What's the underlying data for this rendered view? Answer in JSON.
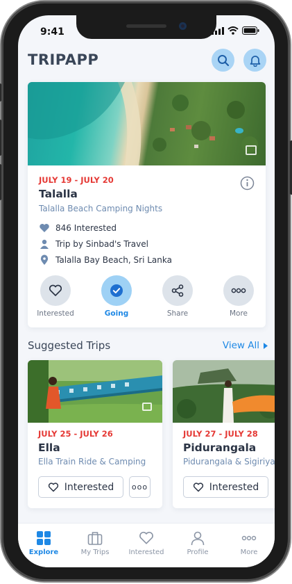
{
  "status_bar": {
    "time": "9:41"
  },
  "header": {
    "title": "TRIPAPP",
    "search_icon": "search-icon",
    "bell_icon": "bell-icon"
  },
  "featured": {
    "dates": "JULY 19 - JULY 20",
    "title": "Talalla",
    "subtitle": "Talalla Beach Camping Nights",
    "interested": "846 Interested",
    "organizer": "Trip by Sinbad's Travel",
    "location": "Talalla Bay Beach, Sri Lanka",
    "actions": [
      {
        "label": "Interested",
        "icon": "heart-icon"
      },
      {
        "label": "Going",
        "icon": "check-icon"
      },
      {
        "label": "Share",
        "icon": "share-icon"
      },
      {
        "label": "More",
        "icon": "more-icon"
      }
    ],
    "selected_action": "Going"
  },
  "suggested": {
    "title": "Suggested Trips",
    "view_all": "View All",
    "trips": [
      {
        "dates": "JULY 25 - JULY 26",
        "title": "Ella",
        "subtitle": "Ella Train Ride & Camping",
        "button": "Interested",
        "more": "ooo"
      },
      {
        "dates": "JULY 27 - JULY 28",
        "title": "Pidurangala",
        "subtitle": "Pidurangala & Sigiriya",
        "button": "Interested"
      }
    ]
  },
  "bottom_nav": {
    "items": [
      {
        "label": "Explore",
        "icon": "grid-icon"
      },
      {
        "label": "My Trips",
        "icon": "suitcase-icon"
      },
      {
        "label": "Interested",
        "icon": "heart-icon"
      },
      {
        "label": "Profile",
        "icon": "user-icon"
      },
      {
        "label": "More",
        "icon": "more-icon"
      }
    ],
    "active": "Explore"
  },
  "colors": {
    "accent": "#1e88e5",
    "date_red": "#e53935",
    "icon_bg": "#a9d4f5"
  }
}
